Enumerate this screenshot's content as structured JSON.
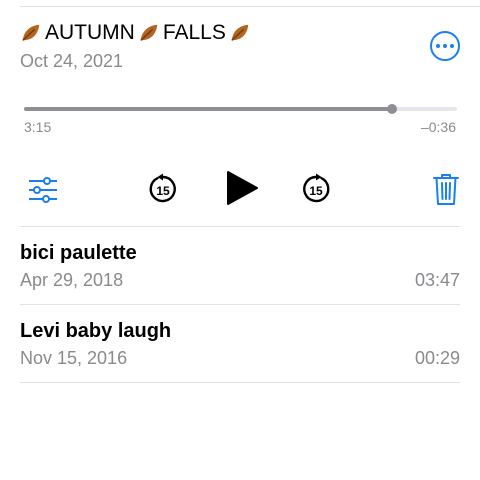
{
  "current": {
    "title_part1": "AUTUMN",
    "title_part2": "FALLS",
    "date": "Oct 24, 2021",
    "elapsed": "3:15",
    "remaining": "–0:36",
    "progress": 0.85
  },
  "controls": [
    "filter-icon",
    "skip-back-15-icon",
    "play-icon",
    "skip-forward-15-icon",
    "trash-icon"
  ],
  "skip_label": "15",
  "recordings": [
    {
      "name": "bici paulette",
      "date": "Apr 29, 2018",
      "duration": "03:47"
    },
    {
      "name": "Levi baby laugh",
      "date": "Nov 15, 2016",
      "duration": "00:29"
    }
  ],
  "colors": {
    "accent": "#1a7ff0",
    "secondary_text": "#8a8a8e"
  }
}
